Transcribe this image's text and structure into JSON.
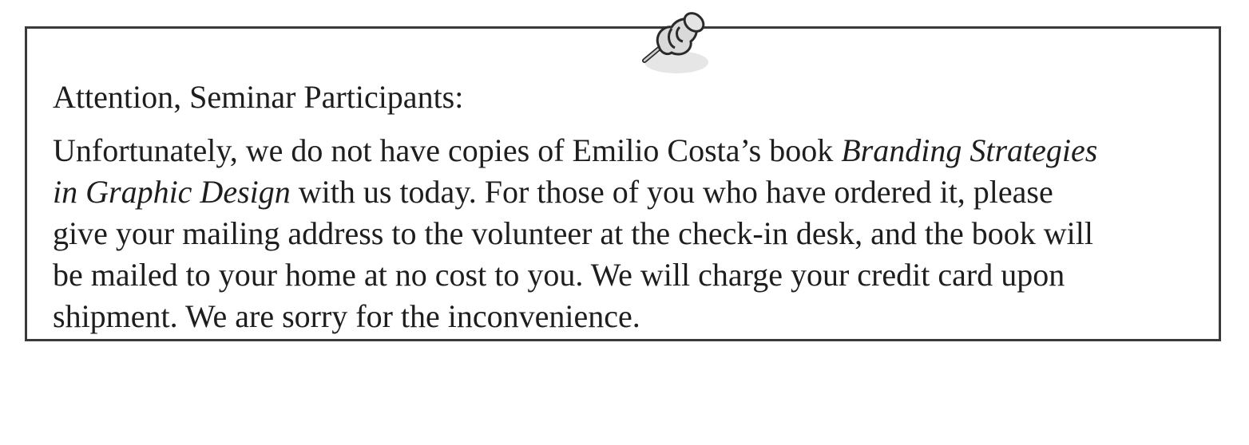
{
  "notice": {
    "heading": "Attention, Seminar Participants:",
    "body": {
      "line1_a": "Unfortunately, we do not have copies of Emilio Costa’s book ",
      "book_title_part1": "Branding Strategies",
      "book_title_part2": "in Graphic Design",
      "line2_b": " with us today. For those of you who have ordered it, please",
      "line3": "give your mailing address to the volunteer at the check-in desk, and the book will",
      "line4": "be mailed to your home at no cost to you. We will charge your credit card upon",
      "line5": "shipment. We are sorry for the inconvenience."
    },
    "icon": "pushpin-icon",
    "colors": {
      "border": "#3a3a3a",
      "text": "#1e1e1e",
      "pin_fill": "#d9d9d9",
      "pin_outline": "#2a2a2a"
    }
  }
}
